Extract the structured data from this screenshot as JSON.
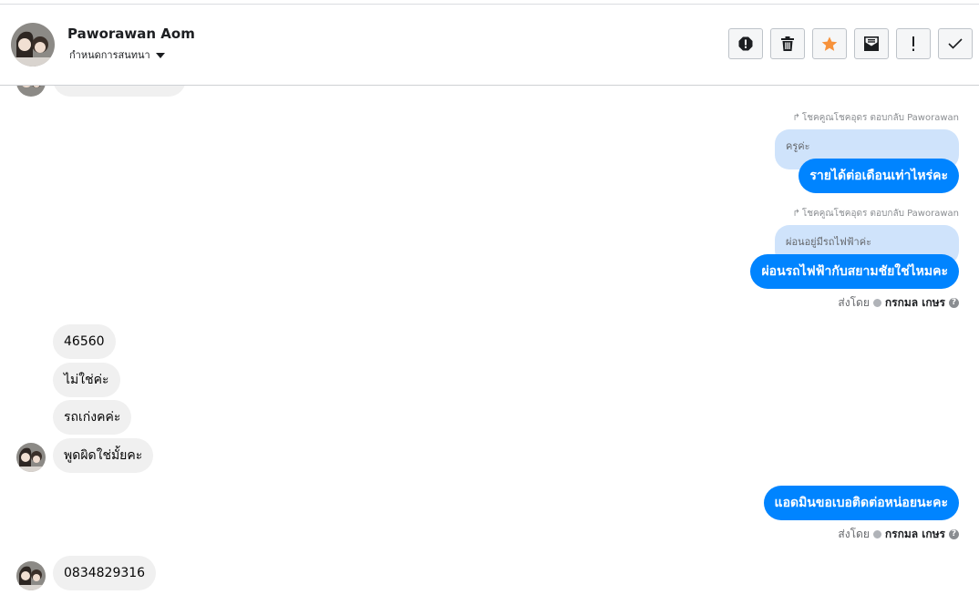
{
  "header": {
    "name": "Paworawan Aom",
    "assign_label": "กำหนดการสนทนา"
  },
  "actions": [
    {
      "id": "spam",
      "icon": "alert-octagon-icon"
    },
    {
      "id": "delete",
      "icon": "trash-icon"
    },
    {
      "id": "star",
      "icon": "star-icon",
      "color": "#f7923b"
    },
    {
      "id": "mark-unread",
      "icon": "envelope-icon"
    },
    {
      "id": "priority",
      "icon": "exclamation-icon"
    },
    {
      "id": "done",
      "icon": "checkmark-icon"
    }
  ],
  "messages": {
    "reply1_meta": "โชคคูณโชคอุดร ตอบกลับ Paworawan",
    "reply1_quote": "ครูค่ะ",
    "reply1_text": "รายได้ต่อเดือนเท่าไหร่คะ",
    "reply2_meta": "โชคคูณโชคอุดร ตอบกลับ Paworawan",
    "reply2_quote": "ผ่อนอยู่มีรถไฟฟ้าค่ะ",
    "reply2_text": "ผ่อนรถไฟฟ้ากับสยามชัยใช่ไหมคะ",
    "sent_by_label": "ส่งโดย",
    "sent_by_name": "กรกมล เกษร",
    "in1": "46560",
    "in2": "ไม่ใช่ค่ะ",
    "in3": "รถเก่งคค่ะ",
    "in4": "พูดผิดใช่มั้ยคะ",
    "out3": "แอดมินขอเบอติดต่อหน่อยนะคะ",
    "in5": "0834829316"
  },
  "colors": {
    "outgoing_bubble": "#0084ff",
    "incoming_bubble": "#f0f0f0",
    "quote_bubble": "#cfe3fb"
  }
}
